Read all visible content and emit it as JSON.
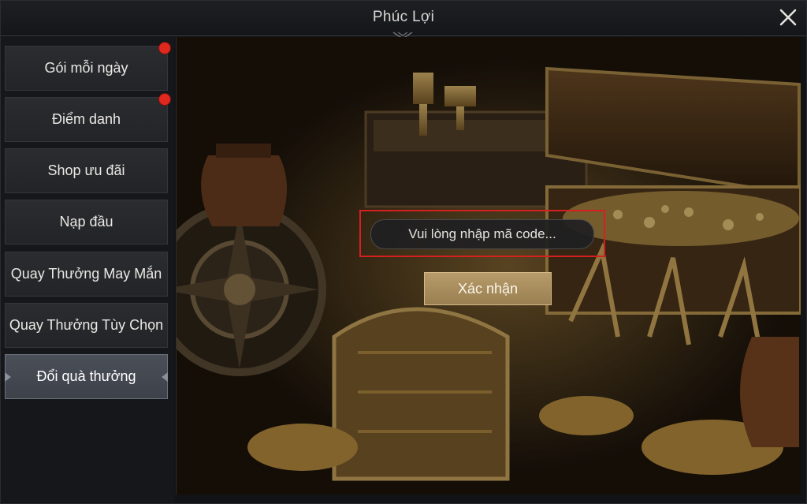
{
  "window": {
    "title": "Phúc Lợi"
  },
  "sidebar": {
    "items": [
      {
        "label": "Gói mỗi ngày",
        "badge": true,
        "active": false
      },
      {
        "label": "Điểm danh",
        "badge": true,
        "active": false
      },
      {
        "label": "Shop ưu đãi",
        "badge": false,
        "active": false
      },
      {
        "label": "Nạp đầu",
        "badge": false,
        "active": false
      },
      {
        "label": "Quay Thưởng May Mắn",
        "badge": false,
        "active": false
      },
      {
        "label": "Quay Thưởng Tùy Chọn",
        "badge": false,
        "active": false
      },
      {
        "label": "Đổi quà thưởng",
        "badge": false,
        "active": true
      }
    ]
  },
  "redeem": {
    "placeholder": "Vui lòng nhập mã code...",
    "confirm_label": "Xác nhận"
  },
  "colors": {
    "highlight_border": "#d61f1f",
    "confirm_button": "#a88c5c",
    "badge": "#e0281e",
    "active_tab": "#454a53"
  },
  "icons": [
    "close-icon",
    "title-ornament-icon"
  ]
}
